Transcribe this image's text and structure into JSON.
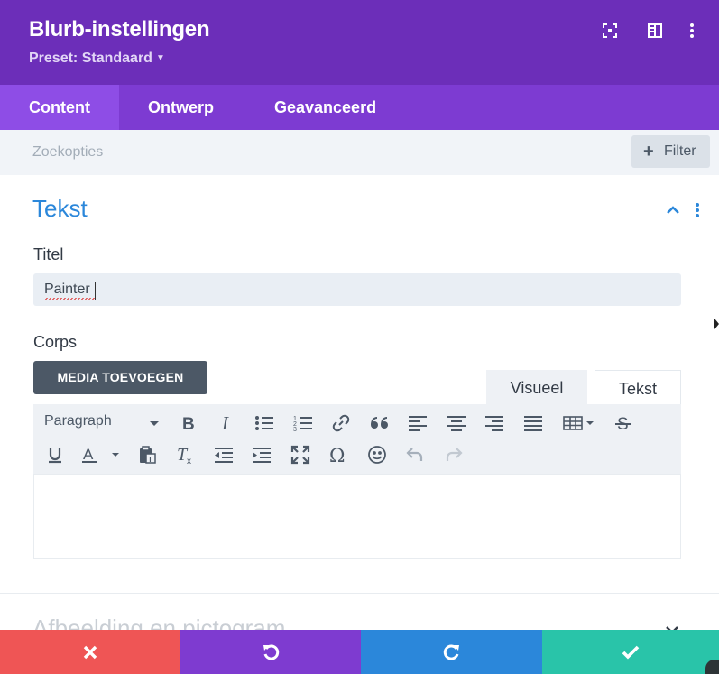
{
  "header": {
    "title": "Blurb-instellingen",
    "preset_label": "Preset: Standaard",
    "icons": [
      "focus-icon",
      "sidebar-layout-icon",
      "more-vertical-icon"
    ],
    "colors": {
      "header_bg": "#6c2eb9",
      "tabs_bg": "#7d3bd2",
      "active_tab_bg": "#8e4de6"
    }
  },
  "tabs": [
    {
      "label": "Content",
      "active": true
    },
    {
      "label": "Ontwerp",
      "active": false
    },
    {
      "label": "Geavanceerd",
      "active": false
    }
  ],
  "search": {
    "placeholder": "Zoekopties",
    "filter_label": "Filter"
  },
  "section": {
    "title": "Tekst",
    "expanded": true,
    "fields": {
      "title_label": "Titel",
      "title_value": "Painter",
      "body_label": "Corps"
    }
  },
  "editor": {
    "media_button": "MEDIA TOEVOEGEN",
    "mode_tabs": [
      "Visueel",
      "Tekst"
    ],
    "format_select": "Paragraph",
    "toolbar_row1": [
      "bold-icon",
      "italic-icon",
      "bullet-list-icon",
      "numbered-list-icon",
      "link-icon",
      "blockquote-icon",
      "align-left-icon",
      "align-center-icon",
      "align-right-icon",
      "align-justify-icon",
      "table-icon",
      "strikethrough-icon"
    ],
    "toolbar_row2": [
      "underline-icon",
      "text-color-icon",
      "paste-text-icon",
      "clear-format-icon",
      "outdent-icon",
      "indent-icon",
      "fullscreen-icon",
      "special-char-icon",
      "emoji-icon",
      "undo-icon",
      "redo-icon"
    ],
    "content": ""
  },
  "next_section": {
    "title": "Afbeelding en pictogram"
  },
  "footer": {
    "buttons": [
      {
        "name": "cancel",
        "icon": "close-icon",
        "color": "#ef5555"
      },
      {
        "name": "undo",
        "icon": "undo-icon",
        "color": "#7e3bd0"
      },
      {
        "name": "redo",
        "icon": "redo-icon",
        "color": "#2b87da"
      },
      {
        "name": "save",
        "icon": "check-icon",
        "color": "#29c4a9"
      }
    ]
  }
}
